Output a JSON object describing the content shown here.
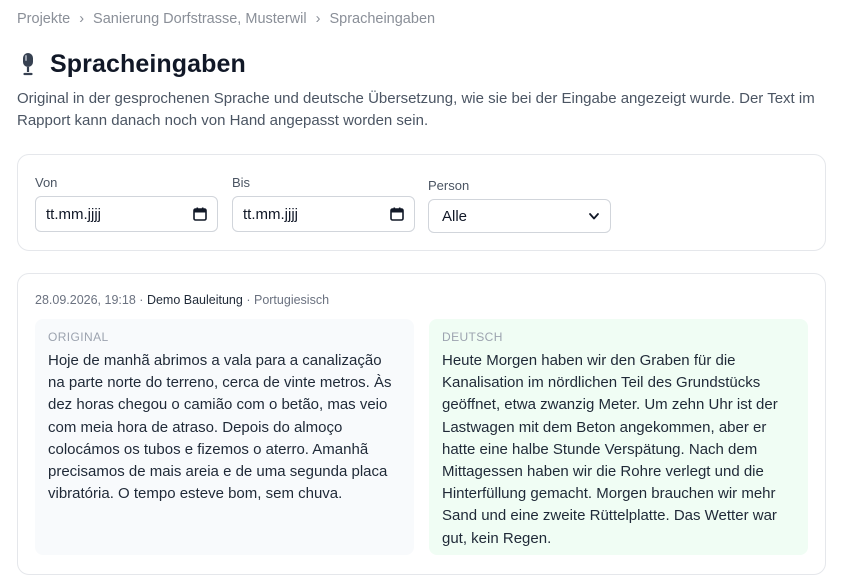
{
  "breadcrumb": {
    "items": [
      "Projekte",
      "Sanierung Dorfstrasse, Musterwil",
      "Spracheingaben"
    ],
    "separator": "›"
  },
  "page": {
    "title": "Spracheingaben",
    "title_icon": "microphone-icon",
    "intro": "Original in der gesprochenen Sprache und deutsche Übersetzung, wie sie bei der Eingabe angezeigt wurde. Der Text im Rapport kann danach noch von Hand angepasst worden sein."
  },
  "filters": {
    "from_label": "Von",
    "from_value": "tt.mm.jjjj",
    "to_label": "Bis",
    "to_value": "tt.mm.jjjj",
    "person_label": "Person",
    "person_value": "Alle"
  },
  "entries": [
    {
      "timestamp": "28.09.2026, 19:18",
      "dot1": "·",
      "person": "Demo Bauleitung",
      "dot2": "·",
      "language": "Portugiesisch",
      "original_label": "ORIGINAL",
      "original_text": "Hoje de manhã abrimos a vala para a canalização na parte norte do terreno, cerca de vinte metros. Às dez horas chegou o camião com o betão, mas veio com meia hora de atraso. Depois do almoço colocámos os tubos e fizemos o aterro. Amanhã precisamos de mais areia e de uma segunda placa vibratória. O tempo esteve bom, sem chuva.",
      "translation_label": "DEUTSCH",
      "translation_text": "Heute Morgen haben wir den Graben für die Kanalisation im nördlichen Teil des Grundstücks geöffnet, etwa zwanzig Meter. Um zehn Uhr ist der Lastwagen mit dem Beton angekommen, aber er hatte eine halbe Stunde Verspätung. Nach dem Mittagessen haben wir die Rohre verlegt und die Hinterfüllung gemacht. Morgen brauchen wir mehr Sand und eine zweite Rüttelplatte. Das Wetter war gut, kein Regen."
    }
  ],
  "colors": {
    "original_panel_bg": "#f8fafc",
    "translation_panel_bg": "#f0fdf4"
  }
}
